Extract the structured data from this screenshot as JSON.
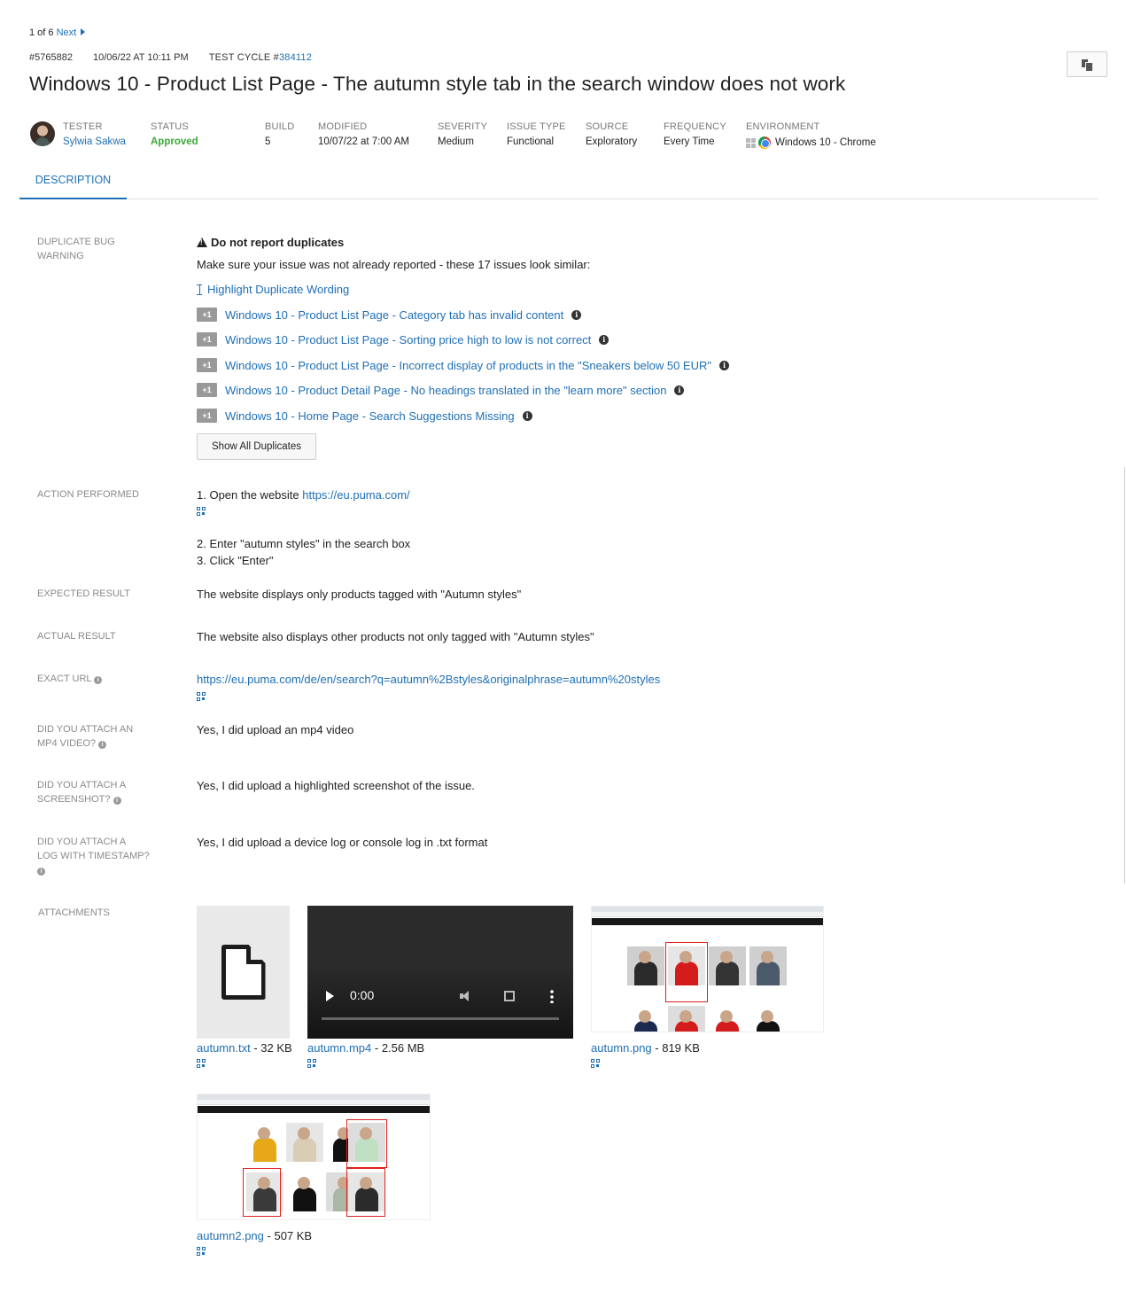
{
  "pager": {
    "position": "1 of 6",
    "next": "Next"
  },
  "meta": {
    "id": "#5765882",
    "date": "10/06/22 AT 10:11 PM",
    "cycle_label": "TEST CYCLE #",
    "cycle_number": "384112"
  },
  "title": "Windows 10 - Product List Page - The autumn style tab in the search window does not work",
  "fields": {
    "tester": {
      "label": "TESTER",
      "value": "Sylwia Sakwa"
    },
    "status": {
      "label": "STATUS",
      "value": "Approved",
      "color": "#3aaa35"
    },
    "build": {
      "label": "BUILD",
      "value": "5"
    },
    "modified": {
      "label": "MODIFIED",
      "value": "10/07/22 at 7:00 AM"
    },
    "severity": {
      "label": "SEVERITY",
      "value": "Medium"
    },
    "issue_type": {
      "label": "ISSUE TYPE",
      "value": "Functional"
    },
    "source": {
      "label": "SOURCE",
      "value": "Exploratory"
    },
    "frequency": {
      "label": "FREQUENCY",
      "value": "Every Time"
    },
    "environment": {
      "label": "ENVIRONMENT",
      "value": "Windows 10 - Chrome"
    }
  },
  "tabs": {
    "description": "DESCRIPTION"
  },
  "duplicate": {
    "label_line1": "DUPLICATE BUG",
    "label_line2": "WARNING",
    "heading": "Do not report duplicates",
    "text": "Make sure your issue was not already reported - these 17 issues look similar:",
    "highlight_link": "Highlight Duplicate Wording",
    "plus_one": "+1",
    "items": [
      "Windows 10 - Product List Page - Category tab has invalid content",
      "Windows 10 - Product List Page - Sorting price high to low is not correct",
      "Windows 10 - Product List Page - Incorrect display of products in the \"Sneakers below 50 EUR\"",
      "Windows 10 - Product Detail Page - No headings translated in the \"learn more\" section",
      "Windows 10 - Home Page - Search Suggestions Missing"
    ],
    "show_all": "Show All Duplicates"
  },
  "action": {
    "label": "ACTION PERFORMED",
    "step1_prefix": "1. Open the website ",
    "step1_link": "https://eu.puma.com/",
    "step2": "2. Enter \"autumn styles\" in the search box",
    "step3": "3. Click \"Enter\""
  },
  "expected": {
    "label": "EXPECTED RESULT",
    "value": "The website displays only products tagged with \"Autumn styles\""
  },
  "actual": {
    "label": "ACTUAL RESULT",
    "value": "The website also displays other products not only tagged with \"Autumn styles\""
  },
  "exact_url": {
    "label": "EXACT URL",
    "value": "https://eu.puma.com/de/en/search?q=autumn%2Bstyles&originalphrase=autumn%20styles"
  },
  "mp4": {
    "label_line1": "DID YOU ATTACH AN",
    "label_line2": "MP4 VIDEO?",
    "value": "Yes, I did upload an mp4 video"
  },
  "screenshot": {
    "label_line1": "DID YOU ATTACH A",
    "label_line2": "SCREENSHOT?",
    "value": "Yes, I did upload a highlighted screenshot of the issue."
  },
  "log": {
    "label_line1": "DID YOU ATTACH A",
    "label_line2": "LOG WITH TIMESTAMP?",
    "value": "Yes, I did upload a device log or console log in .txt format"
  },
  "attachments": {
    "label": "ATTACHMENTS",
    "files": [
      {
        "name": "autumn.txt",
        "size": " - 32 KB"
      },
      {
        "name": "autumn.mp4",
        "size": " - 2.56 MB"
      },
      {
        "name": "autumn.png",
        "size": " - 819 KB"
      },
      {
        "name": "autumn2.png",
        "size": " - 507 KB"
      }
    ],
    "video_time": "0:00"
  }
}
